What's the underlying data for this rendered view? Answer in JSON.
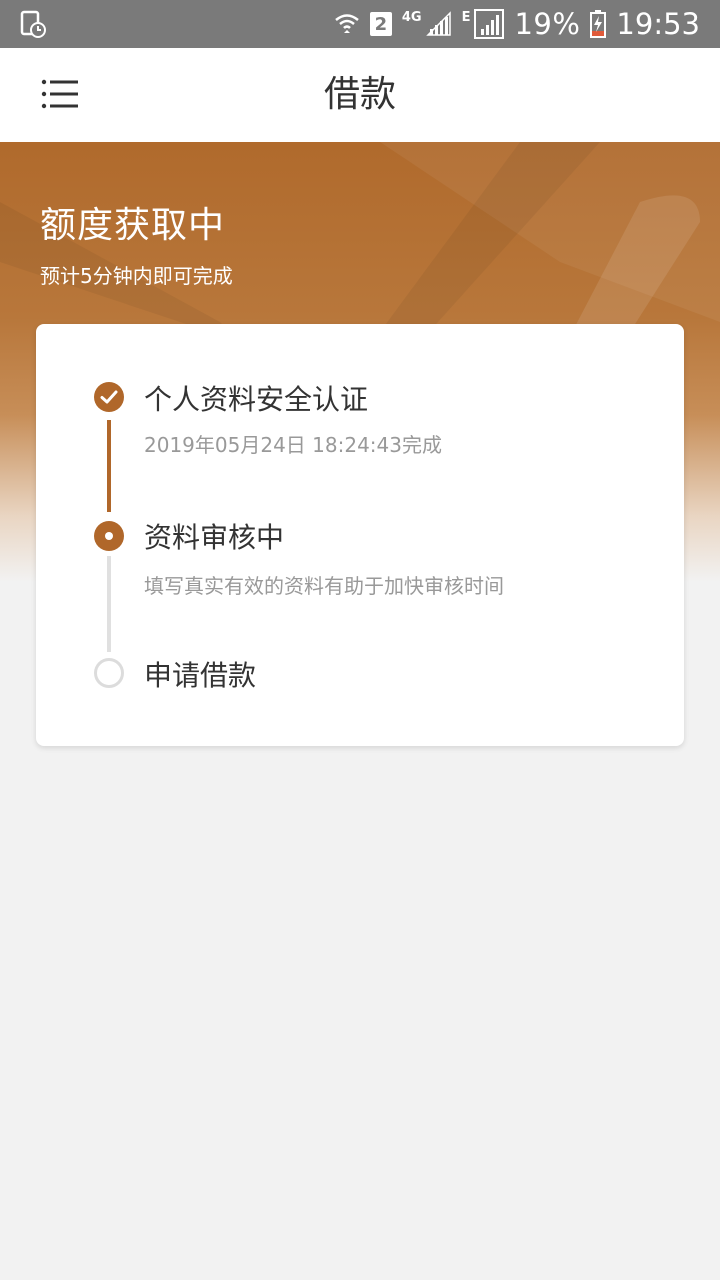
{
  "status_bar": {
    "sim_slot": "2",
    "network_label": "4G",
    "network_label_2": "E",
    "battery_percent": "19%",
    "time": "19:53",
    "icons": [
      "screen-timer-icon",
      "wifi-icon",
      "signal-icon",
      "signal-icon-2",
      "battery-charging-icon"
    ]
  },
  "header": {
    "title": "借款",
    "menu_icon": "menu-icon"
  },
  "banner": {
    "title": "额度获取中",
    "subtitle": "预计5分钟内即可完成"
  },
  "steps": [
    {
      "title": "个人资料安全认证",
      "desc": "2019年05月24日 18:24:43完成",
      "status": "done"
    },
    {
      "title": "资料审核中",
      "desc": "填写真实有效的资料有助于加快审核时间",
      "status": "current"
    },
    {
      "title": "申请借款",
      "desc": "",
      "status": "pending"
    }
  ],
  "colors": {
    "accent": "#b0672a",
    "status_bar": "#7a7a7a",
    "background": "#f2f2f2"
  }
}
